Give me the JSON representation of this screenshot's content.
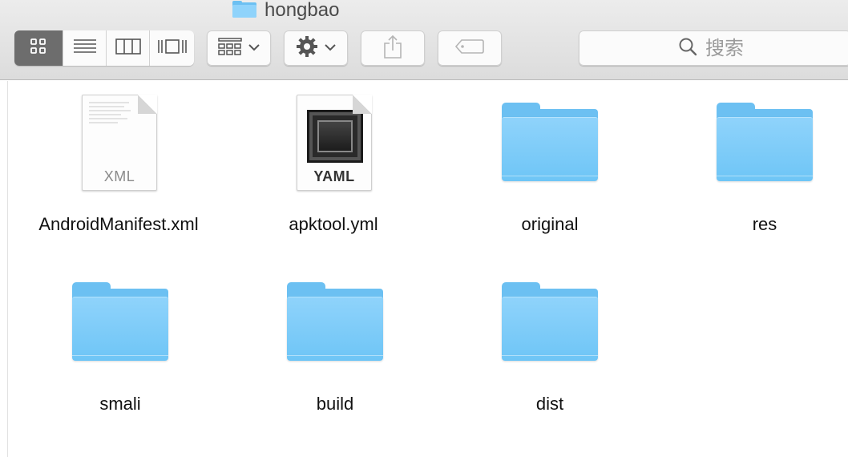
{
  "window": {
    "title": "hongbao"
  },
  "toolbar": {
    "view_modes": [
      {
        "name": "icon-view",
        "active": true
      },
      {
        "name": "list-view",
        "active": false
      },
      {
        "name": "column-view",
        "active": false
      },
      {
        "name": "cover-flow-view",
        "active": false
      }
    ],
    "arrange_icon": "arrange-grid-icon",
    "action_icon": "gear-icon",
    "share_icon": "share-icon",
    "tag_icon": "tag-icon",
    "search": {
      "placeholder": "搜索",
      "value": ""
    }
  },
  "files": {
    "row1": [
      {
        "label": "AndroidManifest.xml",
        "kind": "xml-document",
        "ext": "XML"
      },
      {
        "label": "apktool.yml",
        "kind": "yaml-document",
        "ext": "YAML"
      },
      {
        "label": "original",
        "kind": "folder"
      },
      {
        "label": "res",
        "kind": "folder"
      }
    ],
    "row2": [
      {
        "label": "smali",
        "kind": "folder"
      },
      {
        "label": "build",
        "kind": "folder"
      },
      {
        "label": "dist",
        "kind": "folder"
      }
    ]
  },
  "colors": {
    "folder_blue": "#6cc0f2",
    "active_segment": "#6d6d6d",
    "toolbar_bg": "#e3e3e3"
  }
}
